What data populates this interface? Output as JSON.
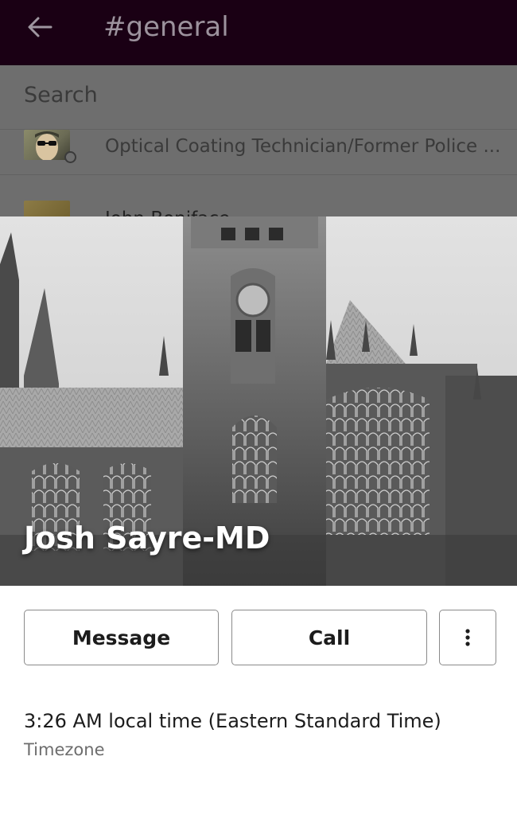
{
  "header": {
    "title": "#general",
    "back_icon": "arrow-left-icon",
    "background": "#1a0014"
  },
  "member_list": {
    "search_label": "Search",
    "rows": [
      {
        "name": "Optical Coating Technician/Former Police ...",
        "status": "offline"
      },
      {
        "name": "John Boniface"
      }
    ]
  },
  "profile": {
    "name": "Josh Sayre-MD",
    "cover_image": "gothic-cathedral-photo",
    "actions": {
      "message_label": "Message",
      "call_label": "Call",
      "more_icon": "more-vertical-icon"
    },
    "local_time": "3:26 AM local time (Eastern Standard Time)",
    "timezone_label": "Timezone"
  }
}
